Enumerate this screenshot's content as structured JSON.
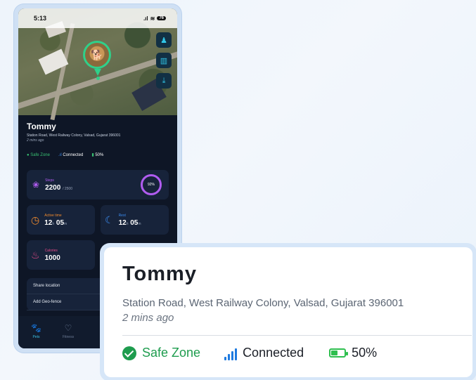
{
  "status_bar": {
    "time": "5:13",
    "signal": ".ıl",
    "wifi": "☰",
    "battery": "76"
  },
  "pet": {
    "name": "Tommy",
    "address": "Station Road, West Railway Colony, Valsad, Gujarat 396001",
    "address_short": "Station Road, West Railway Colony, Valsad, Gujarat 396001",
    "last_seen": "2 mins ago"
  },
  "status": {
    "zone": "Safe Zone",
    "connection": "Connected",
    "battery_percent_label": "50%",
    "battery_level": 0.5,
    "zone_color": "#1e9c4e",
    "signal_color": "#1e7ae0",
    "battery_color": "#2fbf4f"
  },
  "stats": {
    "steps": {
      "label": "Steps",
      "value": "2200",
      "goal": "/ 2500",
      "percent_label": "92%",
      "icon": "paw-icon"
    },
    "active_time": {
      "label": "Active time",
      "h": "12",
      "h_unit": "h",
      "m": "05",
      "m_unit": "m",
      "icon": "clock-icon"
    },
    "rest": {
      "label": "Rest",
      "h": "12",
      "h_unit": "h",
      "m": "05",
      "m_unit": "m",
      "icon": "rest-icon"
    },
    "calories": {
      "label": "Calories",
      "value": "1000",
      "icon": "flame-icon"
    }
  },
  "menu": {
    "items": [
      "Share location",
      "Add Geo-fence"
    ]
  },
  "nav": {
    "items": [
      {
        "label": "Pets",
        "icon": "pets-icon"
      },
      {
        "label": "Fitness",
        "icon": "heart-icon"
      }
    ]
  },
  "map_controls": [
    "person-icon",
    "columns-icon",
    "download-icon"
  ]
}
